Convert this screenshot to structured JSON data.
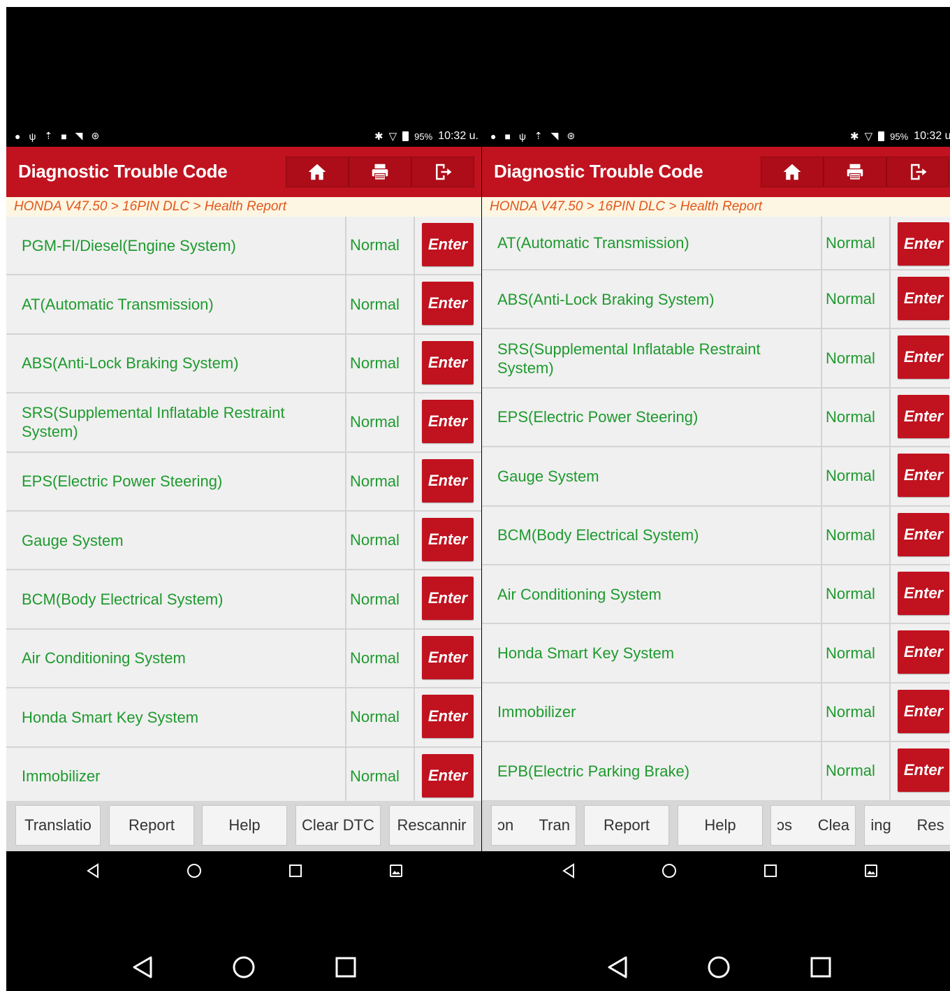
{
  "status_bar": {
    "battery": "95%",
    "time": "10:32 u."
  },
  "header": {
    "title": "Diagnostic Trouble Code"
  },
  "breadcrumb": "HONDA V47.50 > 16PIN DLC > Health Report",
  "left_panel": {
    "rows": [
      {
        "name": "PGM-FI/Diesel(Engine System)",
        "status": "Normal",
        "button": "Enter"
      },
      {
        "name": "AT(Automatic Transmission)",
        "status": "Normal",
        "button": "Enter"
      },
      {
        "name": "ABS(Anti-Lock Braking System)",
        "status": "Normal",
        "button": "Enter"
      },
      {
        "name": "SRS(Supplemental Inflatable Restraint System)",
        "status": "Normal",
        "button": "Enter"
      },
      {
        "name": "EPS(Electric Power Steering)",
        "status": "Normal",
        "button": "Enter"
      },
      {
        "name": "Gauge System",
        "status": "Normal",
        "button": "Enter"
      },
      {
        "name": "BCM(Body Electrical System)",
        "status": "Normal",
        "button": "Enter"
      },
      {
        "name": "Air Conditioning System",
        "status": "Normal",
        "button": "Enter"
      },
      {
        "name": "Honda Smart Key System",
        "status": "Normal",
        "button": "Enter"
      },
      {
        "name": "Immobilizer",
        "status": "Normal",
        "button": "Enter"
      }
    ],
    "footer_buttons": [
      "Translatio",
      "Report",
      "Help",
      "Clear DTC",
      "Rescannir"
    ]
  },
  "right_panel": {
    "rows": [
      {
        "name": "AT(Automatic Transmission)",
        "status": "Normal",
        "button": "Enter"
      },
      {
        "name": "ABS(Anti-Lock Braking System)",
        "status": "Normal",
        "button": "Enter"
      },
      {
        "name": "SRS(Supplemental Inflatable Restraint System)",
        "status": "Normal",
        "button": "Enter"
      },
      {
        "name": "EPS(Electric Power Steering)",
        "status": "Normal",
        "button": "Enter"
      },
      {
        "name": "Gauge System",
        "status": "Normal",
        "button": "Enter"
      },
      {
        "name": "BCM(Body Electrical System)",
        "status": "Normal",
        "button": "Enter"
      },
      {
        "name": "Air Conditioning System",
        "status": "Normal",
        "button": "Enter"
      },
      {
        "name": "Honda Smart Key System",
        "status": "Normal",
        "button": "Enter"
      },
      {
        "name": "Immobilizer",
        "status": "Normal",
        "button": "Enter"
      },
      {
        "name": "EPB(Electric Parking Brake)",
        "status": "Normal",
        "button": "Enter"
      }
    ],
    "footer_buttons": [
      "ɔn      Tran",
      "Report",
      "Help",
      "ↄs      Clea",
      "ing      Res"
    ]
  },
  "icons": {
    "header": [
      "home-icon",
      "print-icon",
      "exit-icon"
    ],
    "navbar": [
      "back-icon",
      "home-circle-icon",
      "recents-icon",
      "screenshot-icon"
    ]
  },
  "colors": {
    "header": "#c1121f",
    "text_green": "#1e9a2e",
    "breadcrumb": "#e2571b"
  }
}
